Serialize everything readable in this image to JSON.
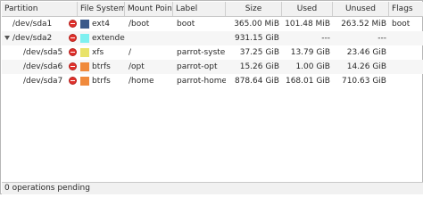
{
  "headers": {
    "partition": "Partition",
    "file_system": "File System",
    "mount_point": "Mount Point",
    "label": "Label",
    "size": "Size",
    "used": "Used",
    "unused": "Unused",
    "flags": "Flags"
  },
  "rows": [
    {
      "partition": "/dev/sda1",
      "fs": "ext4",
      "fs_color": "#3b5a8a",
      "mount": "/boot",
      "label": "boot",
      "size": "365.00 MiB",
      "used": "101.48 MiB",
      "unused": "263.52 MiB",
      "flags": "boot"
    },
    {
      "partition": "/dev/sda2",
      "fs": "extended",
      "fs_color": "#7ef0f0",
      "mount": "",
      "label": "",
      "size": "931.15 GiB",
      "used": "---",
      "unused": "---",
      "flags": ""
    },
    {
      "partition": "/dev/sda5",
      "fs": "xfs",
      "fs_color": "#e9e36a",
      "mount": "/",
      "label": "parrot-syste",
      "size": "37.25 GiB",
      "used": "13.79 GiB",
      "unused": "23.46 GiB",
      "flags": ""
    },
    {
      "partition": "/dev/sda6",
      "fs": "btrfs",
      "fs_color": "#f08a3c",
      "mount": "/opt",
      "label": "parrot-opt",
      "size": "15.26 GiB",
      "used": "1.00 GiB",
      "unused": "14.26 GiB",
      "flags": ""
    },
    {
      "partition": "/dev/sda7",
      "fs": "btrfs",
      "fs_color": "#f08a3c",
      "mount": "/home",
      "label": "parrot-home",
      "size": "878.64 GiB",
      "used": "168.01 GiB",
      "unused": "710.63 GiB",
      "flags": ""
    }
  ],
  "status": "0 operations pending",
  "icons": {
    "lock": "lock-icon",
    "expander": "chevron-down-icon"
  },
  "colors": {
    "lock": "#e0302b",
    "header_bg": "#f1f1f1"
  }
}
